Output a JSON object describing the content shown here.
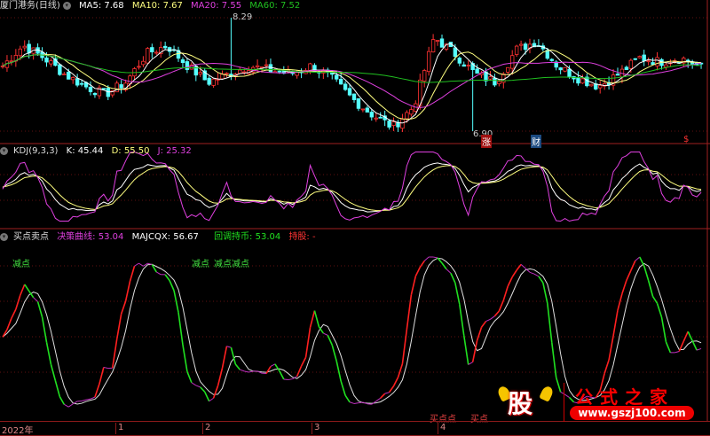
{
  "main_pane": {
    "title": "厦门港务(日线)",
    "ma5": "MA5: 7.68",
    "ma10": "MA10: 7.67",
    "ma20": "MA20: 7.55",
    "ma60": "MA60: 7.52",
    "high_label": "8.29",
    "low_label": "6.90",
    "markers": [
      "涨",
      "财",
      "$"
    ],
    "colors": {
      "up": "#ff3232",
      "down": "#54ffff",
      "ma5": "#ffffff",
      "ma10": "#ffff80",
      "ma20": "#e040e0",
      "ma60": "#20c020"
    }
  },
  "kdj_pane": {
    "title": "KDJ(9,3,3)",
    "k": "K: 45.44",
    "d": "D: 55.50",
    "j": "J: 25.32"
  },
  "signal_pane": {
    "title": "买点卖点",
    "decision": "决策曲线: 53.04",
    "majcqx": "MAJCQX: 56.67",
    "hold_coin": "回调持币: 53.04",
    "hold_stock": "持股: -",
    "sell_labels": [
      "减点",
      "减点",
      "减点减点"
    ],
    "buy_labels": [
      "买点点",
      "买点"
    ]
  },
  "time_axis": [
    "2022年",
    "1",
    "2",
    "3",
    "4"
  ],
  "watermark": {
    "logo_char": "股",
    "title": "公式之家",
    "url": "www.gszj100.com"
  },
  "chart_data": {
    "type": "candlestick",
    "price_range": [
      6.9,
      8.29
    ],
    "close_keypoints": [
      7.7,
      7.95,
      7.8,
      7.6,
      7.45,
      7.35,
      7.5,
      7.85,
      7.95,
      7.7,
      7.5,
      7.6,
      7.7,
      7.65,
      7.6,
      7.7,
      7.55,
      7.3,
      7.1,
      6.95,
      7.2,
      8.05,
      7.85,
      7.6,
      7.5,
      7.9,
      8.0,
      7.7,
      7.55,
      7.45,
      7.6,
      7.8,
      7.75,
      7.8,
      7.68
    ]
  }
}
